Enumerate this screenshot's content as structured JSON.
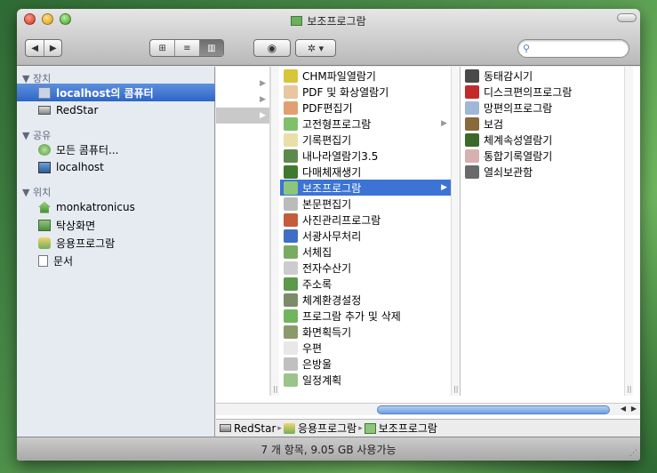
{
  "window": {
    "title": "보조프로그람"
  },
  "toolbar": {
    "back_label": "◀",
    "forward_label": "▶",
    "view_icon_label": "⊞",
    "view_list_label": "≡",
    "view_column_label": "▥",
    "quicklook_label": "◉",
    "action_label": "✲ ▾",
    "search_placeholder": ""
  },
  "sidebar": {
    "sections": [
      {
        "label": "▼ 장치",
        "items": [
          {
            "label": "localhost의 콤퓨터",
            "icon": "computer-icon",
            "selected": true
          },
          {
            "label": "RedStar",
            "icon": "harddisk-icon",
            "selected": false
          }
        ]
      },
      {
        "label": "▼ 공유",
        "items": [
          {
            "label": "모든 콤퓨터...",
            "icon": "network-icon",
            "selected": false
          },
          {
            "label": "localhost",
            "icon": "monitor-icon",
            "selected": false
          }
        ]
      },
      {
        "label": "▼ 위치",
        "items": [
          {
            "label": "monkatronicus",
            "icon": "home-icon",
            "selected": false
          },
          {
            "label": "탁상화면",
            "icon": "desktop-icon",
            "selected": false
          },
          {
            "label": "응용프로그람",
            "icon": "applications-icon",
            "selected": false
          },
          {
            "label": "문서",
            "icon": "documents-icon",
            "selected": false
          }
        ]
      }
    ]
  },
  "columns": {
    "col1": {
      "rows": [
        {
          "label": "",
          "arrow": "▶",
          "state": ""
        },
        {
          "label": "",
          "arrow": "▶",
          "state": ""
        },
        {
          "label": "",
          "arrow": "▶",
          "state": "path"
        }
      ]
    },
    "col2": {
      "rows": [
        {
          "label": "CHM파일열람기",
          "icon": "chm-reader-icon",
          "color": "#d8c53a"
        },
        {
          "label": "PDF 및 화상열람기",
          "icon": "pdf-viewer-icon",
          "color": "#e9c6a0"
        },
        {
          "label": "PDF편집기",
          "icon": "pdf-editor-icon",
          "color": "#e0a072"
        },
        {
          "label": "고전형프로그람",
          "icon": "classic-folder-icon",
          "color": "#7fc06d",
          "arrow": "▶"
        },
        {
          "label": "기록편집기",
          "icon": "text-editor-icon",
          "color": "#e8e0a8"
        },
        {
          "label": "내나라열람기3.5",
          "icon": "browser-icon",
          "color": "#5c8a4c"
        },
        {
          "label": "다매체재생기",
          "icon": "media-player-icon",
          "color": "#3d7a2c"
        },
        {
          "label": "보조프로그람",
          "icon": "accessories-folder-icon",
          "color": "#8fc47d",
          "arrow": "▶",
          "selected": true
        },
        {
          "label": "본문편집기",
          "icon": "document-editor-icon",
          "color": "#bbbbbb"
        },
        {
          "label": "사진관리프로그람",
          "icon": "photo-manager-icon",
          "color": "#c55b3a"
        },
        {
          "label": "서광사무처리",
          "icon": "office-icon",
          "color": "#3e6fc4"
        },
        {
          "label": "서체집",
          "icon": "fonts-icon",
          "color": "#7aab62"
        },
        {
          "label": "전자수산기",
          "icon": "calculator-icon",
          "color": "#cccccc"
        },
        {
          "label": "주소록",
          "icon": "address-book-icon",
          "color": "#5a9a4a"
        },
        {
          "label": "체계환경설정",
          "icon": "system-preferences-icon",
          "color": "#7a8c6a"
        },
        {
          "label": "프로그람 추가 및 삭제",
          "icon": "add-remove-icon",
          "color": "#6fb65f"
        },
        {
          "label": "화면획득기",
          "icon": "screenshot-icon",
          "color": "#8a9a6a"
        },
        {
          "label": "우편",
          "icon": "mail-icon",
          "color": "#e8e8e8"
        },
        {
          "label": "은방울",
          "icon": "lily-icon",
          "color": "#c0c0c0"
        },
        {
          "label": "일정계획",
          "icon": "calendar-icon",
          "color": "#9ac48a"
        }
      ]
    },
    "col3": {
      "rows": [
        {
          "label": "동태감시기",
          "icon": "activity-monitor-icon",
          "color": "#4a4a4a"
        },
        {
          "label": "디스크편의프로그람",
          "icon": "disk-utility-icon",
          "color": "#c42a2a"
        },
        {
          "label": "망편의프로그람",
          "icon": "network-utility-icon",
          "color": "#a0b8d8"
        },
        {
          "label": "보검",
          "icon": "keychain-icon",
          "color": "#8a6a3a"
        },
        {
          "label": "체계속성열람기",
          "icon": "system-profiler-icon",
          "color": "#3a6a2a"
        },
        {
          "label": "통합기록열람기",
          "icon": "console-icon",
          "color": "#d8b0b0"
        },
        {
          "label": "열쇠보관함",
          "icon": "key-storage-icon",
          "color": "#6a6a6a"
        }
      ]
    }
  },
  "pathbar": {
    "items": [
      {
        "label": "RedStar",
        "icon": "harddisk-icon"
      },
      {
        "label": "응용프로그람",
        "icon": "applications-icon"
      },
      {
        "label": "보조프로그람",
        "icon": "accessories-folder-icon"
      }
    ],
    "separator": "▸"
  },
  "status": {
    "text": "7 개 항목, 9.05 GB 사용가능"
  }
}
